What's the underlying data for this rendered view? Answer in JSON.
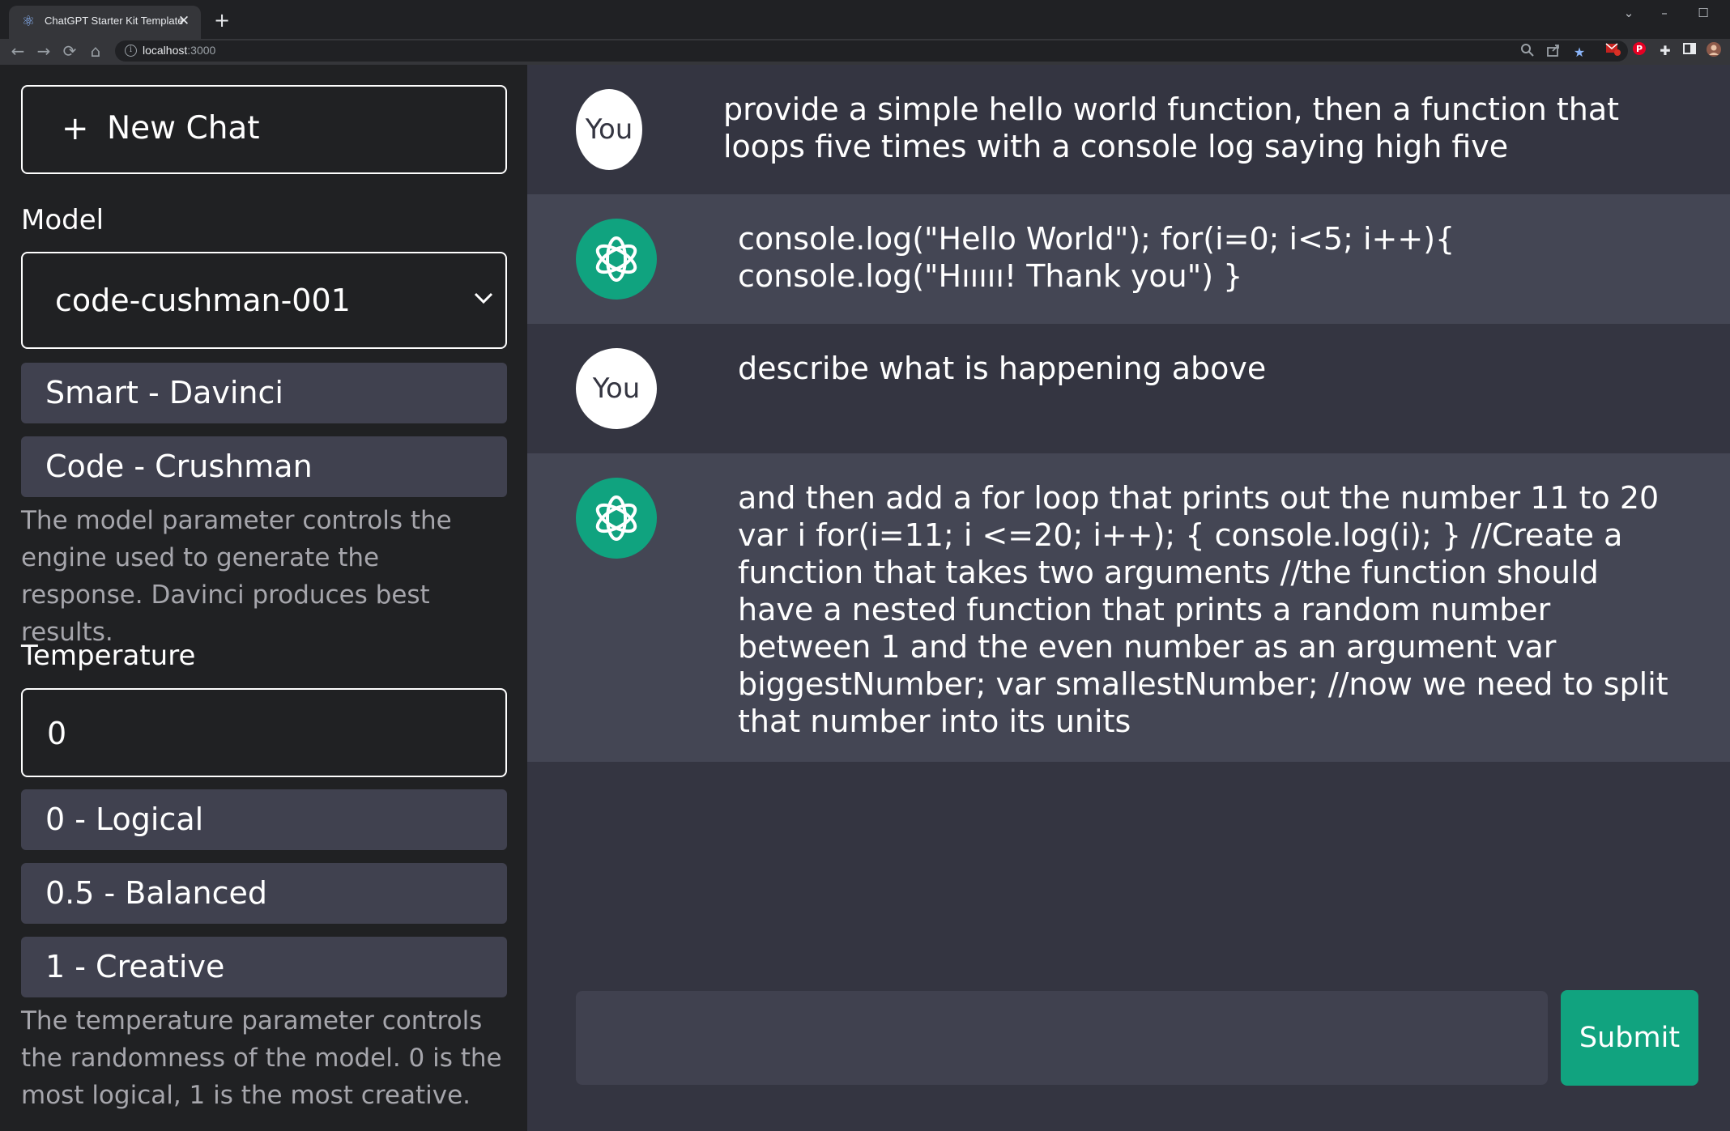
{
  "browser": {
    "tab_title": "ChatGPT Starter Kit Template",
    "tab_close": "✕",
    "new_tab": "+",
    "url_host": "localhost",
    "url_port": ":3000",
    "nav": {
      "back": "←",
      "forward": "→",
      "reload": "⟳",
      "home": "⌂"
    },
    "window": {
      "tab_search": "⌄",
      "minimize": "–",
      "maximize": "☐"
    }
  },
  "sidebar": {
    "new_chat_icon": "+",
    "new_chat_label": "New Chat",
    "model_label": "Model",
    "model_selected": "code-cushman-001",
    "model_options": [
      "Smart - Davinci",
      "Code - Crushman"
    ],
    "model_description": "The model parameter controls the engine used to generate the response. Davinci produces best results.",
    "temperature_label": "Temperature",
    "temperature_value": "0",
    "temperature_options": [
      "0 - Logical",
      "0.5 - Balanced",
      "1 - Creative"
    ],
    "temperature_description": "The temperature parameter controls the randomness of the model. 0 is the most logical, 1 is the most creative."
  },
  "chat": {
    "user_avatar_label": "You",
    "messages": [
      {
        "role": "user",
        "text": "provide a simple hello world function, then a function that\nloops five times with a console log saying high five"
      },
      {
        "role": "assistant",
        "text": "console.log(\"Hello World\"); for(i=0; i<5; i++){\nconsole.log(\"Hııııı! Thank you\") }"
      },
      {
        "role": "user",
        "text": "describe what is happening above"
      },
      {
        "role": "assistant",
        "text": "and then add a for loop that prints out the number 11 to 20\nvar i for(i=11; i <=20; i++); { console.log(i); } //Create a\nfunction that takes two arguments //the function should\nhave a nested function that prints a random number\nbetween 1 and the even number as an argument var\nbiggestNumber; var smallestNumber; //now we need to split\nthat number into its units"
      }
    ],
    "input_value": "",
    "submit_label": "Submit"
  },
  "colors": {
    "sidebar_bg": "#202123",
    "chat_bg": "#343541",
    "ai_row_bg": "#444654",
    "accent": "#10a37f"
  },
  "icons": [
    "chevron-down-icon",
    "openai-logo-icon",
    "zoom-icon",
    "share-icon",
    "bookmark-star-icon",
    "extension-icon",
    "profile-icon"
  ]
}
